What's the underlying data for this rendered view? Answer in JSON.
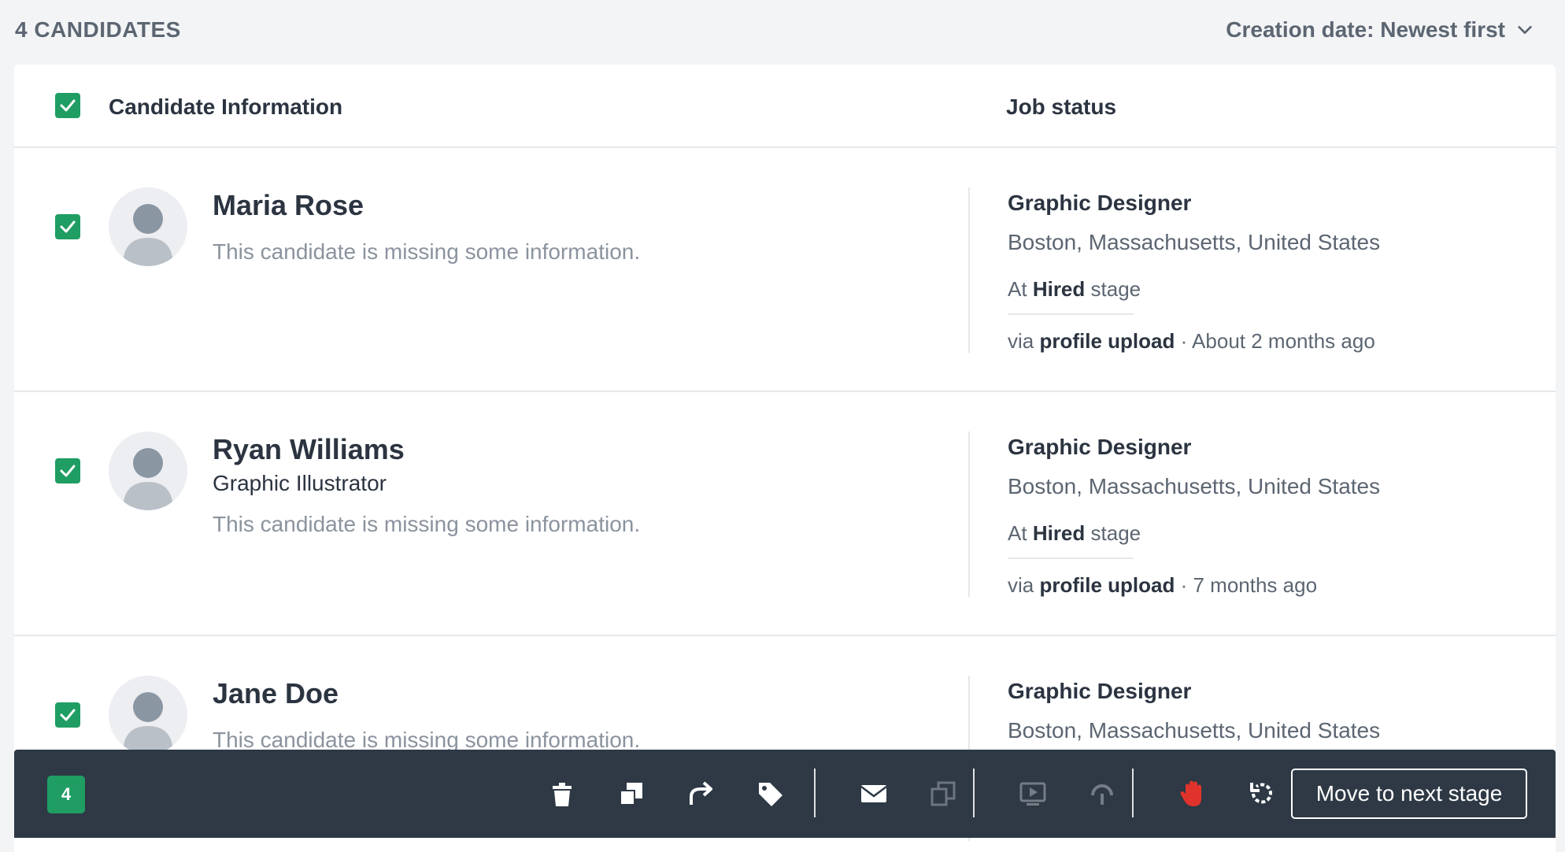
{
  "list": {
    "count_title": "4 CANDIDATES",
    "sort_label": "Creation date: Newest first",
    "sort_icon": "chevron-down-icon"
  },
  "table": {
    "header": {
      "candidate_info": "Candidate Information",
      "job_status": "Job status"
    },
    "rows": [
      {
        "name": "Maria Rose",
        "subtitle": "",
        "missing": "This candidate is missing some information.",
        "job_title": "Graphic Designer",
        "location": "Boston, Massachusetts, United States",
        "stage_prefix": "At",
        "stage_name": "Hired",
        "stage_suffix": "stage",
        "via_prefix": "via",
        "source": "profile upload",
        "time": "· About 2 months ago",
        "checked": true
      },
      {
        "name": "Ryan Williams",
        "subtitle": "Graphic Illustrator",
        "missing": "This candidate is missing some information.",
        "job_title": "Graphic Designer",
        "location": "Boston, Massachusetts, United States",
        "stage_prefix": "At",
        "stage_name": "Hired",
        "stage_suffix": "stage",
        "via_prefix": "via",
        "source": "profile upload",
        "time": "· 7 months ago",
        "checked": true
      },
      {
        "name": "Jane Doe",
        "subtitle": "",
        "missing": "This candidate is missing some information.",
        "job_title": "Graphic Designer",
        "location": "Boston, Massachusetts, United States",
        "checked": true
      }
    ]
  },
  "bulk_bar": {
    "selected_count": "4",
    "tools": [
      "trash-icon",
      "copy-icon",
      "forward-icon",
      "tag-icon",
      "email-icon",
      "copy-disabled-icon",
      "video-icon",
      "assessment-icon",
      "stop-hand-icon",
      "undo-icon"
    ],
    "next_stage_label": "Move to next stage"
  },
  "colors": {
    "accent_green": "#1f9d63",
    "bar_bg": "#2e3945",
    "stop_red": "#e0332b"
  }
}
